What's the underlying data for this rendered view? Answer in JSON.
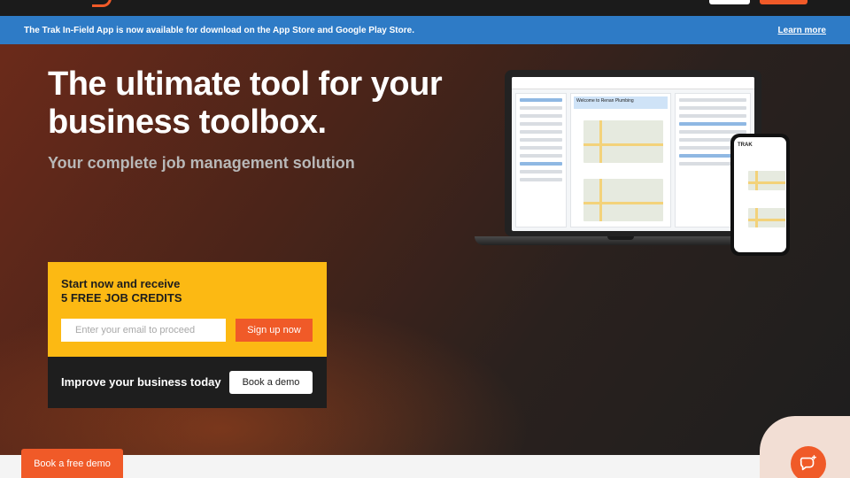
{
  "announcement": {
    "text": "The Trak In-Field App is now available for download on the App Store and Google Play Store.",
    "link_label": "Learn more"
  },
  "hero": {
    "headline": "The ultimate tool for your business toolbox.",
    "subtitle": "Your complete job management solution"
  },
  "cta": {
    "title_line1": "Start now and receive",
    "title_line2": "5 FREE JOB CREDITS",
    "email_placeholder": "Enter your email to proceed",
    "signup_label": "Sign up now",
    "improve_text": "Improve your business today",
    "demo_label": "Book a demo"
  },
  "floating": {
    "free_demo_label": "Book a free demo"
  },
  "device": {
    "laptop_welcome": "Welcome to Renan Plumbing",
    "phone_logo": "TRAK"
  },
  "colors": {
    "brand_orange": "#f05a28",
    "brand_yellow": "#fcb913",
    "announce_blue": "#2e7bc6"
  }
}
